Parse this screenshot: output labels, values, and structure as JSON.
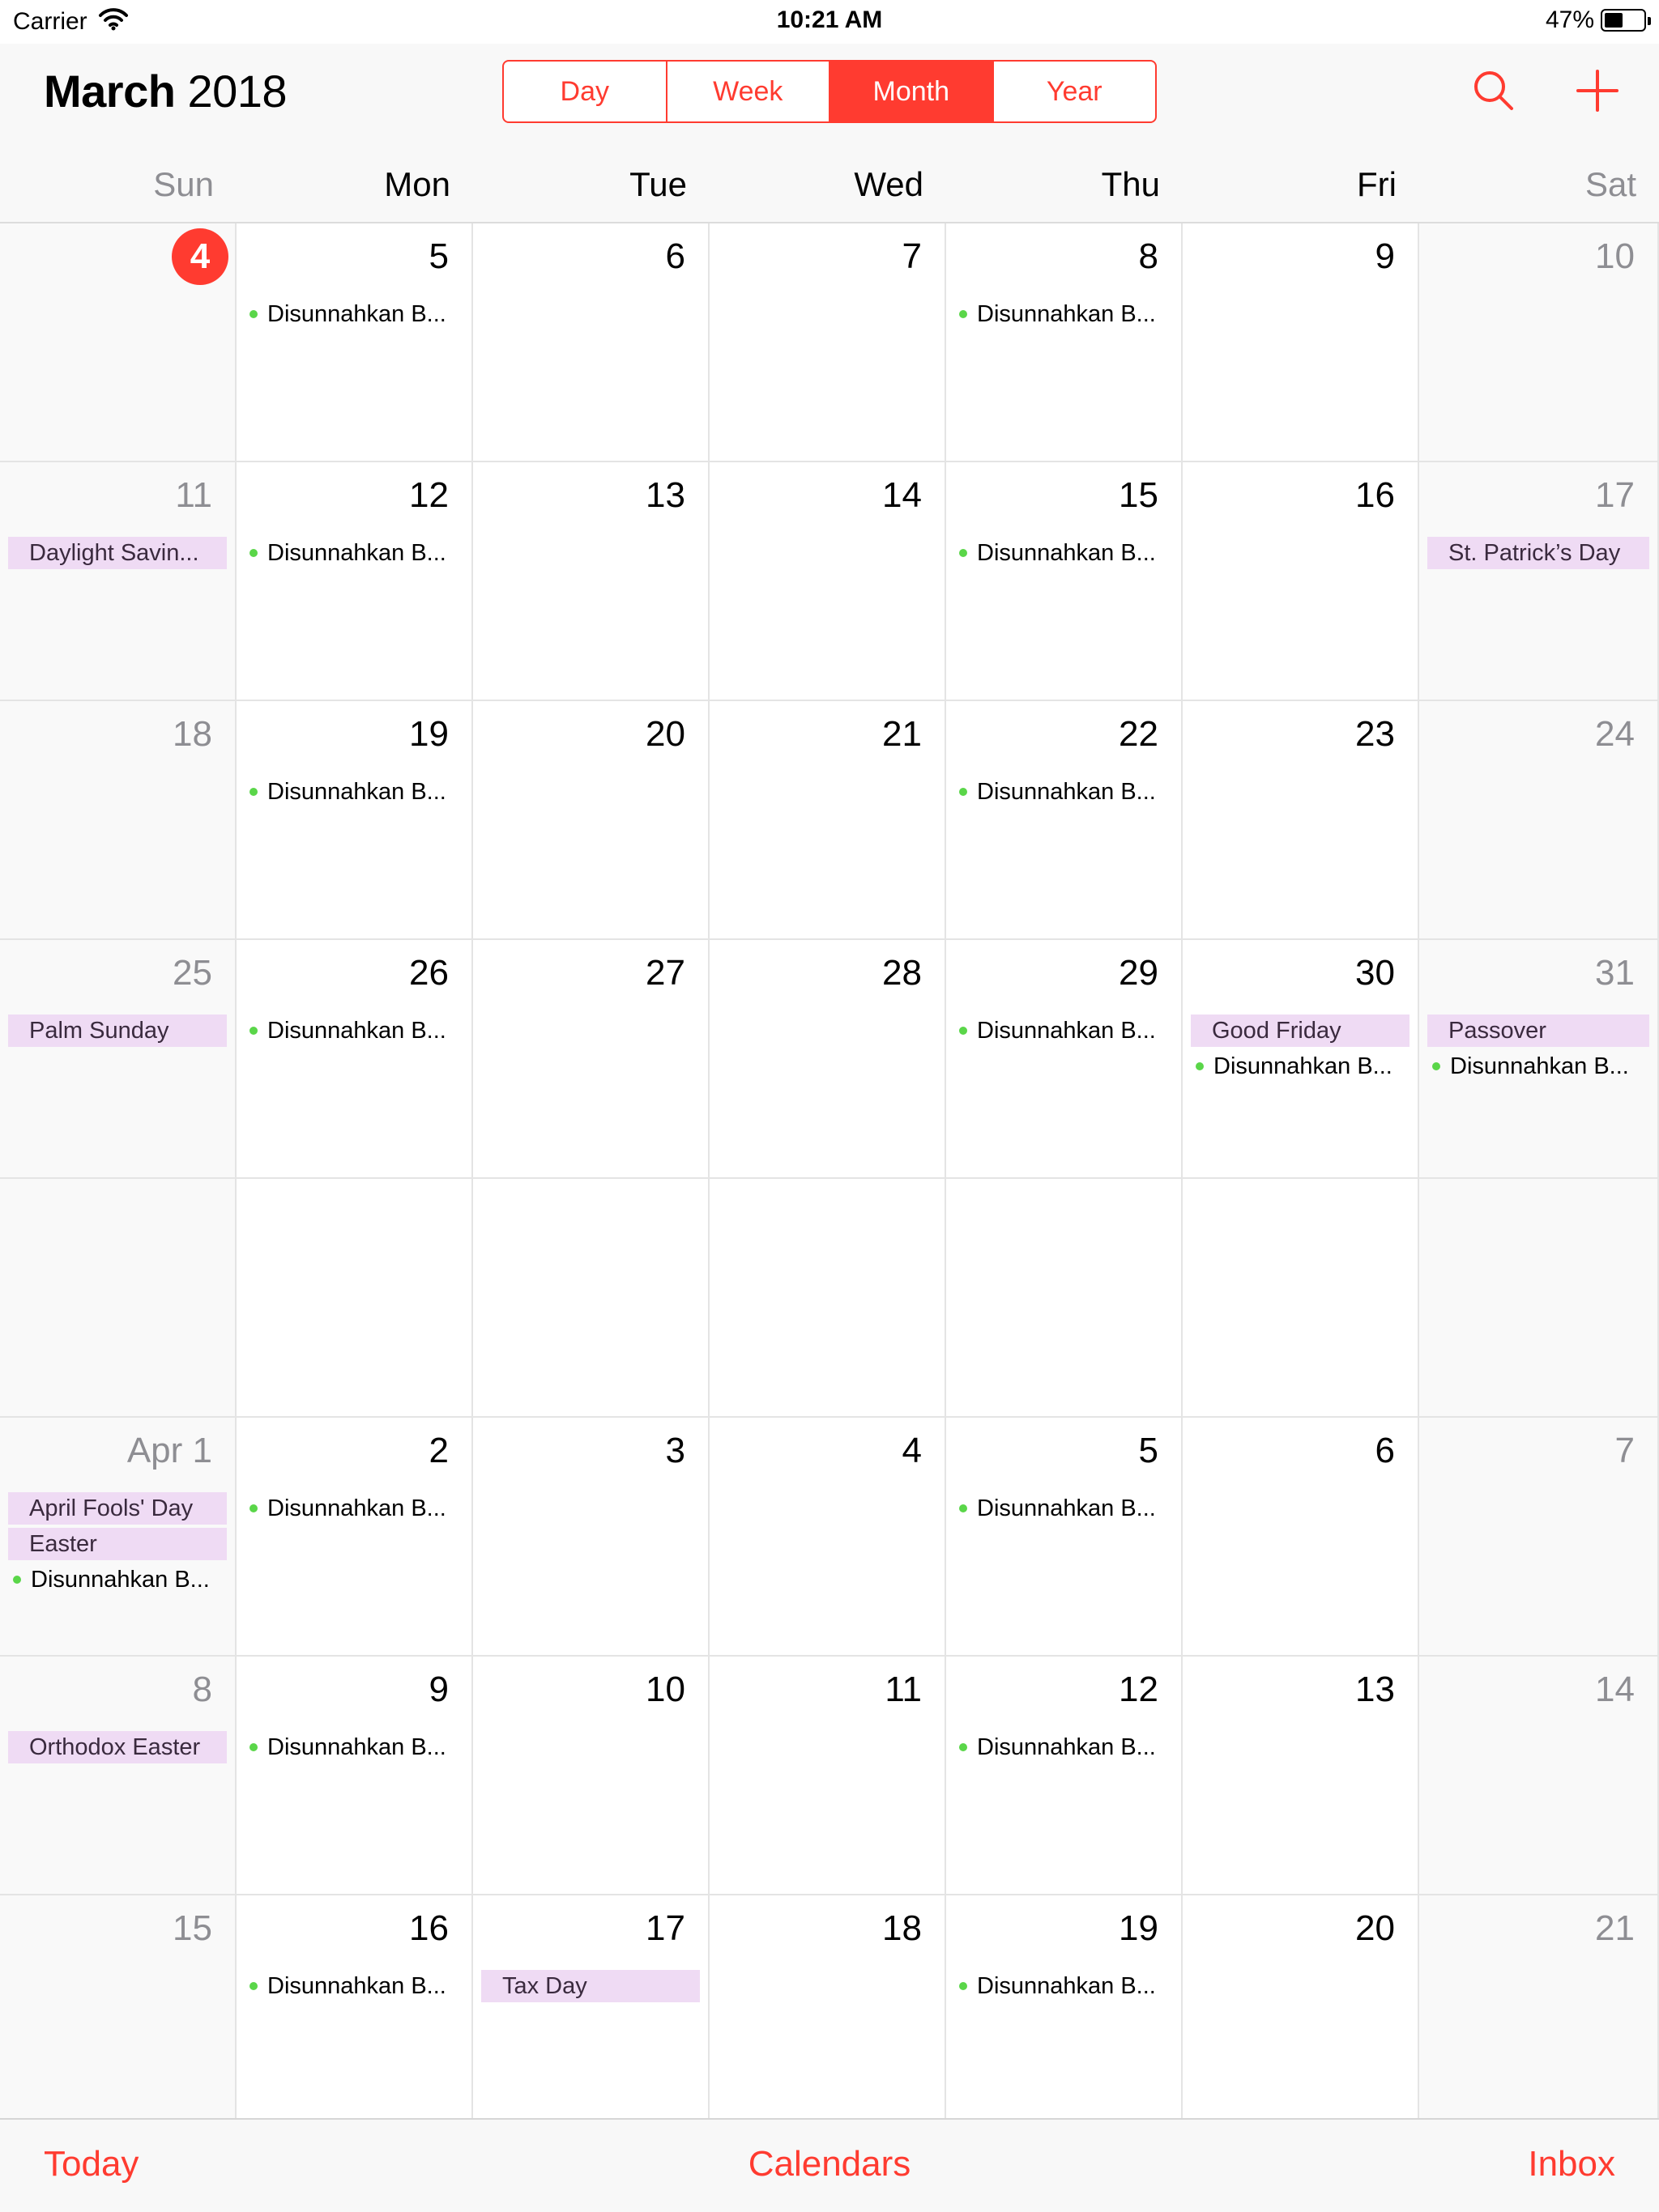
{
  "status_bar": {
    "carrier": "Carrier",
    "time": "10:21 AM",
    "battery": "47%",
    "battery_level": 0.47
  },
  "header": {
    "title_month": "March",
    "title_year": "2018",
    "segments": [
      "Day",
      "Week",
      "Month",
      "Year"
    ],
    "selected_segment": "Month"
  },
  "colors": {
    "accent": "#ff3b30",
    "allday_event_bg": "#efdbf4",
    "event_dot": "#5ad649",
    "weekend_text": "#8e8e93"
  },
  "weekdays": [
    "Sun",
    "Mon",
    "Tue",
    "Wed",
    "Thu",
    "Fri",
    "Sat"
  ],
  "weeks": [
    [
      {
        "day": "4",
        "today": true,
        "events": []
      },
      {
        "day": "5",
        "events": [
          {
            "type": "dot",
            "title": "Disunnahkan B..."
          }
        ]
      },
      {
        "day": "6",
        "events": []
      },
      {
        "day": "7",
        "events": []
      },
      {
        "day": "8",
        "events": [
          {
            "type": "dot",
            "title": "Disunnahkan B..."
          }
        ]
      },
      {
        "day": "9",
        "events": []
      },
      {
        "day": "10",
        "events": []
      }
    ],
    [
      {
        "day": "11",
        "events": [
          {
            "type": "allday",
            "title": "Daylight Savin..."
          }
        ]
      },
      {
        "day": "12",
        "events": [
          {
            "type": "dot",
            "title": "Disunnahkan B..."
          }
        ]
      },
      {
        "day": "13",
        "events": []
      },
      {
        "day": "14",
        "events": []
      },
      {
        "day": "15",
        "events": [
          {
            "type": "dot",
            "title": "Disunnahkan B..."
          }
        ]
      },
      {
        "day": "16",
        "events": []
      },
      {
        "day": "17",
        "events": [
          {
            "type": "allday",
            "title": "St. Patrick’s Day"
          }
        ]
      }
    ],
    [
      {
        "day": "18",
        "events": []
      },
      {
        "day": "19",
        "events": [
          {
            "type": "dot",
            "title": "Disunnahkan B..."
          }
        ]
      },
      {
        "day": "20",
        "events": []
      },
      {
        "day": "21",
        "events": []
      },
      {
        "day": "22",
        "events": [
          {
            "type": "dot",
            "title": "Disunnahkan B..."
          }
        ]
      },
      {
        "day": "23",
        "events": []
      },
      {
        "day": "24",
        "events": []
      }
    ],
    [
      {
        "day": "25",
        "events": [
          {
            "type": "allday",
            "title": "Palm Sunday"
          }
        ]
      },
      {
        "day": "26",
        "events": [
          {
            "type": "dot",
            "title": "Disunnahkan B..."
          }
        ]
      },
      {
        "day": "27",
        "events": []
      },
      {
        "day": "28",
        "events": []
      },
      {
        "day": "29",
        "events": [
          {
            "type": "dot",
            "title": "Disunnahkan B..."
          }
        ]
      },
      {
        "day": "30",
        "events": [
          {
            "type": "allday",
            "title": "Good Friday"
          },
          {
            "type": "dot",
            "title": "Disunnahkan B..."
          }
        ]
      },
      {
        "day": "31",
        "events": [
          {
            "type": "allday",
            "title": "Passover"
          },
          {
            "type": "dot",
            "title": "Disunnahkan B..."
          }
        ]
      }
    ],
    [
      {
        "day": "",
        "events": []
      },
      {
        "day": "",
        "events": []
      },
      {
        "day": "",
        "events": []
      },
      {
        "day": "",
        "events": []
      },
      {
        "day": "",
        "events": []
      },
      {
        "day": "",
        "events": []
      },
      {
        "day": "",
        "events": []
      }
    ],
    [
      {
        "day": "Apr 1",
        "events": [
          {
            "type": "allday",
            "title": "April Fools' Day"
          },
          {
            "type": "allday",
            "title": "Easter"
          },
          {
            "type": "dot",
            "title": "Disunnahkan B..."
          }
        ]
      },
      {
        "day": "2",
        "events": [
          {
            "type": "dot",
            "title": "Disunnahkan B..."
          }
        ]
      },
      {
        "day": "3",
        "events": []
      },
      {
        "day": "4",
        "events": []
      },
      {
        "day": "5",
        "events": [
          {
            "type": "dot",
            "title": "Disunnahkan B..."
          }
        ]
      },
      {
        "day": "6",
        "events": []
      },
      {
        "day": "7",
        "events": []
      }
    ],
    [
      {
        "day": "8",
        "events": [
          {
            "type": "allday",
            "title": "Orthodox Easter"
          }
        ]
      },
      {
        "day": "9",
        "events": [
          {
            "type": "dot",
            "title": "Disunnahkan B..."
          }
        ]
      },
      {
        "day": "10",
        "events": []
      },
      {
        "day": "11",
        "events": []
      },
      {
        "day": "12",
        "events": [
          {
            "type": "dot",
            "title": "Disunnahkan B..."
          }
        ]
      },
      {
        "day": "13",
        "events": []
      },
      {
        "day": "14",
        "events": []
      }
    ],
    [
      {
        "day": "15",
        "events": []
      },
      {
        "day": "16",
        "events": [
          {
            "type": "dot",
            "title": "Disunnahkan B..."
          }
        ]
      },
      {
        "day": "17",
        "events": [
          {
            "type": "allday",
            "title": "Tax Day"
          }
        ]
      },
      {
        "day": "18",
        "events": []
      },
      {
        "day": "19",
        "events": [
          {
            "type": "dot",
            "title": "Disunnahkan B..."
          }
        ]
      },
      {
        "day": "20",
        "events": []
      },
      {
        "day": "21",
        "events": []
      }
    ]
  ],
  "tabbar": {
    "today": "Today",
    "calendars": "Calendars",
    "inbox": "Inbox"
  }
}
